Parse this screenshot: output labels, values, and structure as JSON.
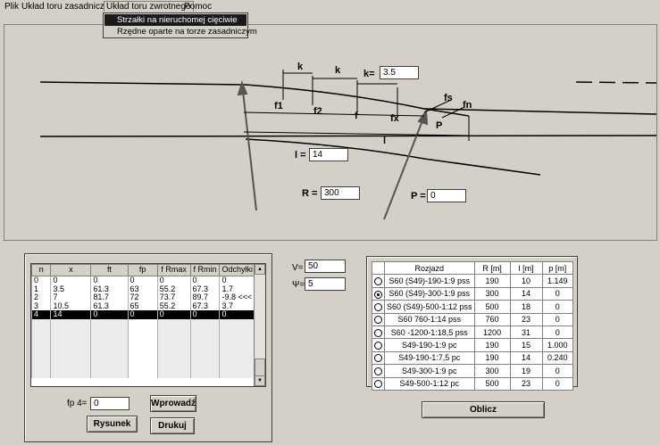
{
  "menu": {
    "items": [
      "Plik",
      "Układ toru zasadniczego",
      "Układ toru zwrotnego",
      "Pomoc"
    ],
    "dropdown": [
      "Strzałki na nieruchomej cięciwie",
      "Rzędne oparte na torze zasadniczym"
    ]
  },
  "drawing": {
    "labels": {
      "k1": "k",
      "k2": "k",
      "k_eq": "k=",
      "f1": "f1",
      "f2": "f2",
      "f": "f",
      "fx": "fx",
      "fs": "fs",
      "fn": "fn",
      "P_small": "P",
      "l_small": "l",
      "l_eq": "l =",
      "R_eq": "R =",
      "P_eq": "P ="
    },
    "values": {
      "k": "3.5",
      "l": "14",
      "R": "300",
      "P": "0"
    }
  },
  "grid": {
    "headers": [
      "n",
      "x",
      "ft",
      "fp",
      "f Rmax",
      "f Rmin",
      "Odchyłki"
    ],
    "rows": [
      [
        "0",
        "0",
        "0",
        "0",
        "0",
        "0",
        "0"
      ],
      [
        "1",
        "3.5",
        "61.3",
        "63",
        "55.2",
        "67.3",
        "1.7"
      ],
      [
        "2",
        "7",
        "81.7",
        "72",
        "73.7",
        "89.7",
        "-9.8 <<<"
      ],
      [
        "3",
        "10.5",
        "61.3",
        "65",
        "55.2",
        "67.3",
        "3.7"
      ],
      [
        "4",
        "14",
        "0",
        "0",
        "0",
        "0",
        "0"
      ]
    ],
    "selected_row": 4,
    "scroll_up": "▲",
    "scroll_down": "▼"
  },
  "controls": {
    "fp_label": "fp  4=",
    "fp_value": "0",
    "btn_wprowadz": "Wprowadź",
    "btn_rysunek": "Rysunek",
    "btn_drukuj": "Drukuj"
  },
  "params": {
    "V_label": "V=",
    "V_value": "50",
    "Y_label": "Ψ=",
    "Y_value": "5"
  },
  "rtable": {
    "headers": [
      "Rozjazd",
      "R [m]",
      "l [m]",
      "p [m]"
    ],
    "rows": [
      [
        "S60 (S49)-190-1:9 pss",
        "190",
        "10",
        "1.149"
      ],
      [
        "S60 (S49)-300-1:9 pss",
        "300",
        "14",
        "0"
      ],
      [
        "S60 (S49)-500-1:12 pss",
        "500",
        "18",
        "0"
      ],
      [
        "S60 760-1:14 pss",
        "760",
        "23",
        "0"
      ],
      [
        "S60 -1200-1:18,5 pss",
        "1200",
        "31",
        "0"
      ],
      [
        "S49-190-1:9 pc",
        "190",
        "15",
        "1.000"
      ],
      [
        "S49-190-1:7,5 pc",
        "190",
        "14",
        "0.240"
      ],
      [
        "S49-300-1:9 pc",
        "300",
        "19",
        "0"
      ],
      [
        "S49-500-1:12 pc",
        "500",
        "23",
        "0"
      ]
    ],
    "selected_row": 1
  },
  "oblicz_label": "Oblicz"
}
